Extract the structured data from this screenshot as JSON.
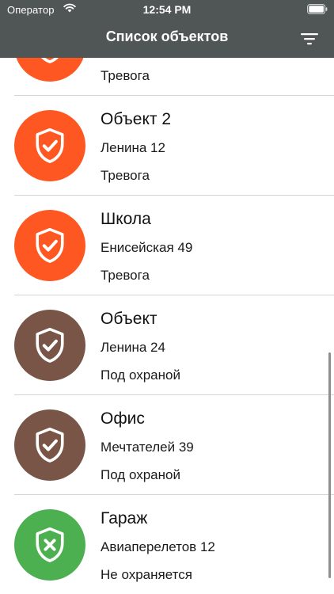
{
  "status_bar": {
    "carrier": "Оператор",
    "time": "12:54 PM",
    "icons": [
      "wifi-icon",
      "battery-icon"
    ]
  },
  "nav": {
    "title": "Список объектов",
    "filter_icon": "filter-icon"
  },
  "colors": {
    "header": "#505656",
    "alarm": "#FF5722",
    "armed": "#795548",
    "disarmed": "#4CAF50"
  },
  "objects": [
    {
      "name": "",
      "address": "",
      "status": "Тревога",
      "state": "alarm",
      "icon": "shield-check-icon"
    },
    {
      "name": "Объект 2",
      "address": "Ленина 12",
      "status": "Тревога",
      "state": "alarm",
      "icon": "shield-check-icon"
    },
    {
      "name": "Школа",
      "address": "Енисейская 49",
      "status": "Тревога",
      "state": "alarm",
      "icon": "shield-check-icon"
    },
    {
      "name": "Объект",
      "address": "Ленина 24",
      "status": "Под охраной",
      "state": "armed",
      "icon": "shield-check-icon"
    },
    {
      "name": "Офис",
      "address": "Мечтателей 39",
      "status": "Под охраной",
      "state": "armed",
      "icon": "shield-check-icon"
    },
    {
      "name": "Гараж",
      "address": "Авиаперелетов 12",
      "status": "Не охраняется",
      "state": "disarmed",
      "icon": "shield-x-icon"
    }
  ]
}
